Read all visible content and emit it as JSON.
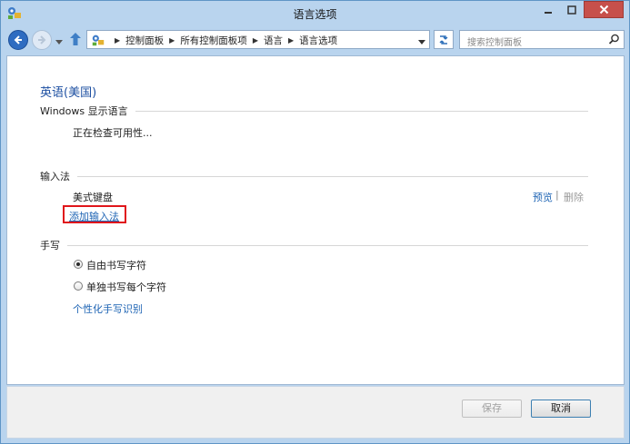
{
  "window": {
    "title": "语言选项"
  },
  "navigation": {
    "breadcrumbs": [
      "控制面板",
      "所有控制面板项",
      "语言",
      "语言选项"
    ],
    "search_placeholder": "搜索控制面板"
  },
  "language": {
    "name": "英语(美国)",
    "display_section_label": "Windows 显示语言",
    "display_status": "正在检查可用性..."
  },
  "input_method": {
    "section_label": "输入法",
    "keyboard_name": "美式键盘",
    "preview_link": "预览",
    "link_separator": "|",
    "delete_link": "删除",
    "add_link": "添加输入法"
  },
  "handwriting": {
    "section_label": "手写",
    "options": [
      {
        "label": "自由书写字符",
        "selected": true
      },
      {
        "label": "单独书写每个字符",
        "selected": false
      }
    ],
    "personalize_link": "个性化手写识别"
  },
  "buttons": {
    "save": "保存",
    "save_enabled": false,
    "cancel": "取消"
  },
  "colors": {
    "link": "#1e64b4",
    "highlight_box": "#e0161b",
    "close_button": "#c7504b"
  },
  "icons": [
    "control-panel-icon",
    "back-icon",
    "forward-icon",
    "history-dropdown-icon",
    "up-arrow-icon",
    "refresh-icon",
    "search-icon",
    "minimize-icon",
    "maximize-icon",
    "close-icon"
  ]
}
